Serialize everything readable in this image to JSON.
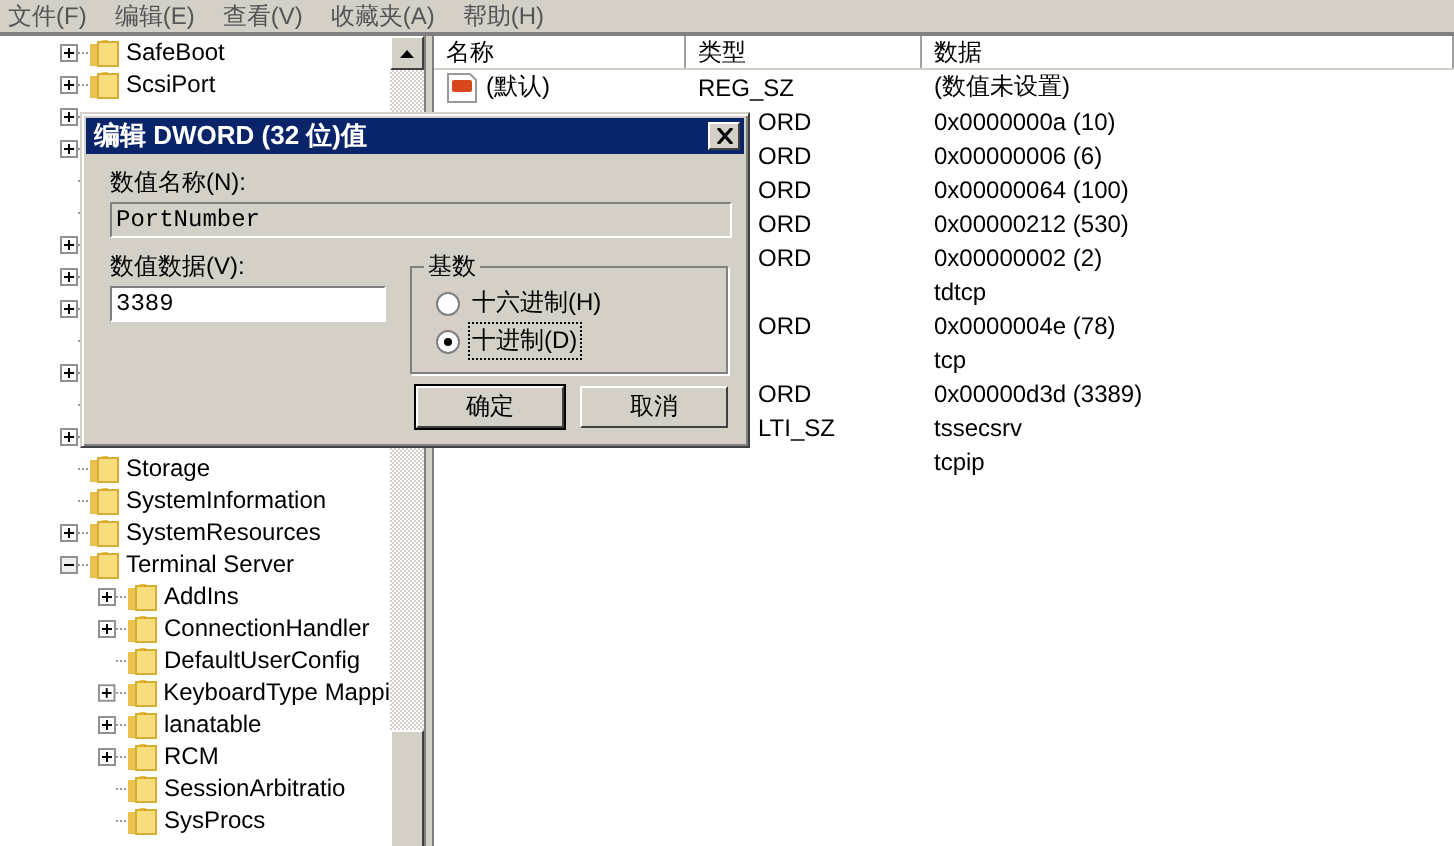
{
  "menu": [
    {
      "label": "文件(F)"
    },
    {
      "label": "编辑(E)"
    },
    {
      "label": "查看(V)"
    },
    {
      "label": "收藏夹(A)"
    },
    {
      "label": "帮助(H)"
    }
  ],
  "tree": {
    "items": [
      {
        "label": "SafeBoot",
        "kind": "branch",
        "expanded": false
      },
      {
        "label": "ScsiPort",
        "kind": "branch",
        "expanded": false
      },
      {
        "kind": "branch",
        "expanded": false
      },
      {
        "kind": "branch",
        "expanded": false
      },
      {
        "kind": "leaf"
      },
      {
        "kind": "leaf"
      },
      {
        "kind": "branch",
        "expanded": false
      },
      {
        "kind": "branch",
        "expanded": false
      },
      {
        "kind": "branch",
        "expanded": false
      },
      {
        "kind": "leaf"
      },
      {
        "kind": "branch",
        "expanded": false
      },
      {
        "kind": "leaf"
      },
      {
        "kind": "branch",
        "expanded": false
      },
      {
        "label": "Storage",
        "kind": "leaf"
      },
      {
        "label": "SystemInformation",
        "kind": "leaf"
      },
      {
        "label": "SystemResources",
        "kind": "branch",
        "expanded": false
      },
      {
        "label": "Terminal Server",
        "kind": "branch",
        "expanded": true,
        "children": [
          {
            "label": "AddIns",
            "kind": "branch",
            "expanded": false
          },
          {
            "label": "ConnectionHandler",
            "kind": "branch",
            "expanded": false
          },
          {
            "label": "DefaultUserConfig",
            "kind": "leaf"
          },
          {
            "label": "KeyboardType Mappi",
            "kind": "branch",
            "expanded": false
          },
          {
            "label": "lanatable",
            "kind": "branch",
            "expanded": false
          },
          {
            "label": "RCM",
            "kind": "branch",
            "expanded": false
          },
          {
            "label": "SessionArbitratio",
            "kind": "leaf"
          },
          {
            "label": "SysProcs",
            "kind": "leaf"
          }
        ]
      }
    ]
  },
  "list": {
    "columns": [
      "名称",
      "类型",
      "数据"
    ],
    "rows": [
      {
        "kind": "visible",
        "name": "(默认)",
        "type": "REG_SZ",
        "data": "(数值未设置)"
      },
      {
        "kind": "covered",
        "type": "ORD",
        "data": "0x0000000a (10)"
      },
      {
        "kind": "covered",
        "type": "ORD",
        "data": "0x00000006 (6)"
      },
      {
        "kind": "covered",
        "type": "ORD",
        "data": "0x00000064 (100)"
      },
      {
        "kind": "covered",
        "type": "ORD",
        "data": "0x00000212 (530)"
      },
      {
        "kind": "covered",
        "type": "ORD",
        "data": "0x00000002 (2)"
      },
      {
        "kind": "covered",
        "data": "tdtcp"
      },
      {
        "kind": "covered",
        "type": "ORD",
        "data": "0x0000004e (78)"
      },
      {
        "kind": "covered",
        "data": "tcp"
      },
      {
        "kind": "covered",
        "type": "ORD",
        "data": "0x00000d3d (3389)"
      },
      {
        "kind": "covered",
        "type": "LTI_SZ",
        "data": "tssecsrv"
      },
      {
        "kind": "covered",
        "data": "tcpip"
      }
    ]
  },
  "dialog": {
    "title": "编辑 DWORD (32 位)值",
    "name_label": "数值名称(N):",
    "name_value": "PortNumber",
    "data_label": "数值数据(V):",
    "data_value": "3389",
    "base": {
      "title": "基数",
      "options": [
        {
          "label": "十六进制(H)",
          "selected": false
        },
        {
          "label": "十进制(D)",
          "selected": true
        }
      ]
    },
    "buttons": [
      {
        "label": "确定",
        "default": true
      },
      {
        "label": "取消",
        "default": false
      }
    ]
  }
}
